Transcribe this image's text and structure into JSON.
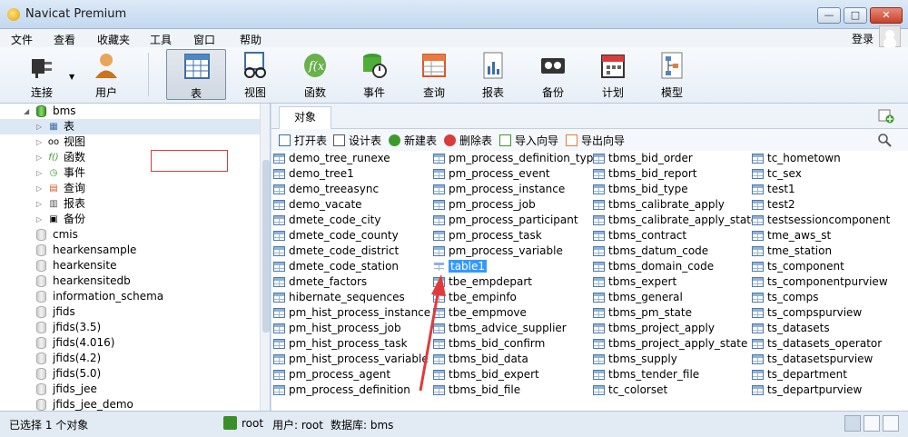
{
  "window": {
    "title": "Navicat Premium",
    "min": "—",
    "max": "□",
    "close": "✕"
  },
  "menu": [
    "文件",
    "查看",
    "收藏夹",
    "工具",
    "窗口",
    "帮助"
  ],
  "login_label": "登录",
  "toolbar": [
    {
      "label": "连接",
      "icon": "plug-icon"
    },
    {
      "label": "用户",
      "icon": "user-icon"
    },
    {
      "label": "表",
      "icon": "table-icon",
      "active": true
    },
    {
      "label": "视图",
      "icon": "view-icon"
    },
    {
      "label": "函数",
      "icon": "function-icon"
    },
    {
      "label": "事件",
      "icon": "event-icon"
    },
    {
      "label": "查询",
      "icon": "query-icon"
    },
    {
      "label": "报表",
      "icon": "report-icon"
    },
    {
      "label": "备份",
      "icon": "backup-icon"
    },
    {
      "label": "计划",
      "icon": "schedule-icon"
    },
    {
      "label": "模型",
      "icon": "model-icon"
    }
  ],
  "tree": {
    "root": "bms",
    "children": [
      "表",
      "视图",
      "函数",
      "事件",
      "查询",
      "报表",
      "备份"
    ],
    "databases": [
      "cmis",
      "hearkensample",
      "hearkensite",
      "hearkensitedb",
      "information_schema",
      "jfids",
      "jfids(3.5)",
      "jfids(4.016)",
      "jfids(4.2)",
      "jfids(5.0)",
      "jfids_jee",
      "jfids_jee_demo"
    ]
  },
  "tab_label": "对象",
  "obj_toolbar": [
    "打开表",
    "设计表",
    "新建表",
    "删除表",
    "导入向导",
    "导出向导"
  ],
  "columns": [
    [
      "demo_tree_runexe",
      "demo_tree1",
      "demo_treeasync",
      "demo_vacate",
      "dmete_code_city",
      "dmete_code_county",
      "dmete_code_district",
      "dmete_code_station",
      "dmete_factors",
      "hibernate_sequences",
      "pm_hist_process_instance",
      "pm_hist_process_job",
      "pm_hist_process_task",
      "pm_hist_process_variable",
      "pm_process_agent",
      "pm_process_definition"
    ],
    [
      "pm_process_definition_type",
      "pm_process_event",
      "pm_process_instance",
      "pm_process_job",
      "pm_process_participant",
      "pm_process_task",
      "pm_process_variable",
      "table1",
      "tbe_empdepart",
      "tbe_empinfo",
      "tbe_empmove",
      "tbms_advice_supplier",
      "tbms_bid_confirm",
      "tbms_bid_data",
      "tbms_bid_expert",
      "tbms_bid_file"
    ],
    [
      "tbms_bid_order",
      "tbms_bid_report",
      "tbms_bid_type",
      "tbms_calibrate_apply",
      "tbms_calibrate_apply_state",
      "tbms_contract",
      "tbms_datum_code",
      "tbms_domain_code",
      "tbms_expert",
      "tbms_general",
      "tbms_pm_state",
      "tbms_project_apply",
      "tbms_project_apply_state",
      "tbms_supply",
      "tbms_tender_file",
      "tc_colorset"
    ],
    [
      "tc_hometown",
      "tc_sex",
      "test1",
      "test2",
      "testsessioncomponent",
      "tme_aws_st",
      "tme_station",
      "ts_component",
      "ts_componentpurview",
      "ts_comps",
      "ts_compspurview",
      "ts_datasets",
      "ts_datasets_operator",
      "ts_datasetspurview",
      "ts_department",
      "ts_departpurview"
    ]
  ],
  "selected_table": "table1",
  "status": {
    "selection": "已选择 1 个对象",
    "connection": "root",
    "user": "用户: root",
    "database": "数据库: bms"
  },
  "colors": {
    "selection": "#3399ff",
    "annotation": "#e23a3a"
  }
}
